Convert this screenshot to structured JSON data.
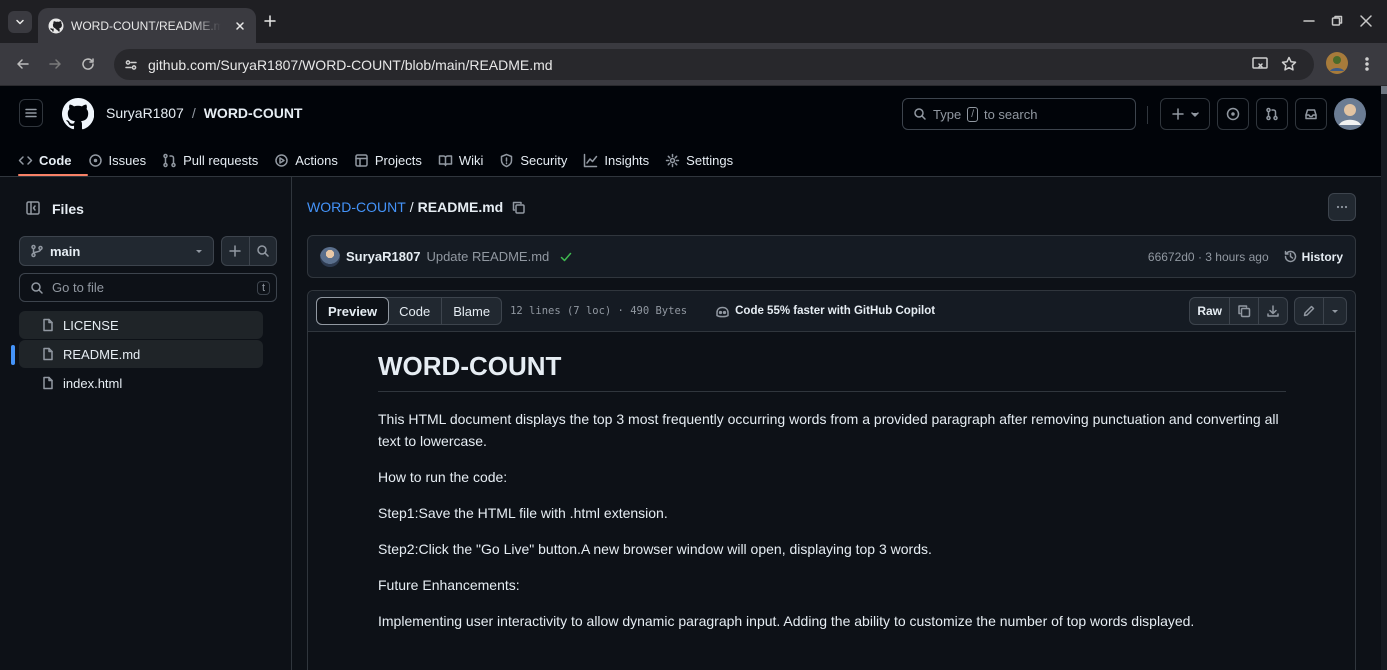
{
  "browser": {
    "tab_title": "WORD-COUNT/README.md at main",
    "url": "github.com/SuryaR1807/WORD-COUNT/blob/main/README.md"
  },
  "header": {
    "owner": "SuryaR1807",
    "separator": "/",
    "repo": "WORD-COUNT",
    "search_prefix": "Type",
    "search_key": "/",
    "search_suffix": "to search"
  },
  "repo_nav": [
    {
      "label": "Code",
      "icon": "code-icon"
    },
    {
      "label": "Issues",
      "icon": "issue-icon"
    },
    {
      "label": "Pull requests",
      "icon": "pull-request-icon"
    },
    {
      "label": "Actions",
      "icon": "play-icon"
    },
    {
      "label": "Projects",
      "icon": "table-icon"
    },
    {
      "label": "Wiki",
      "icon": "book-icon"
    },
    {
      "label": "Security",
      "icon": "shield-icon"
    },
    {
      "label": "Insights",
      "icon": "graph-icon"
    },
    {
      "label": "Settings",
      "icon": "gear-icon"
    }
  ],
  "sidebar": {
    "title": "Files",
    "branch": "main",
    "goto_placeholder": "Go to file",
    "goto_key": "t",
    "files": [
      "LICENSE",
      "README.md",
      "index.html"
    ],
    "selected": "README.md"
  },
  "breadcrumb": {
    "repo": "WORD-COUNT",
    "separator": "/",
    "file": "README.md"
  },
  "commit": {
    "author": "SuryaR1807",
    "message": "Update README.md",
    "meta": "66672d0 · 3 hours ago",
    "history_label": "History"
  },
  "file_toolbar": {
    "tabs": [
      "Preview",
      "Code",
      "Blame"
    ],
    "active_tab": "Preview",
    "stats": "12 lines (7 loc) · 490 Bytes",
    "copilot": "Code 55% faster with GitHub Copilot",
    "raw_label": "Raw"
  },
  "readme": {
    "heading": "WORD-COUNT",
    "paragraphs": [
      "This HTML document displays the top 3 most frequently occurring words from a provided paragraph after removing punctuation and converting all text to lowercase.",
      "How to run the code:",
      "Step1:Save the HTML file with .html extension.",
      "Step2:Click the \"Go Live\" button.A new browser window will open, displaying top 3 words.",
      "Future Enhancements:",
      "Implementing user interactivity to allow dynamic paragraph input. Adding the ability to customize the number of top words displayed."
    ]
  },
  "colors": {
    "accent_link": "#4493f8",
    "success": "#3fb950",
    "nav_underline": "#f78166"
  }
}
